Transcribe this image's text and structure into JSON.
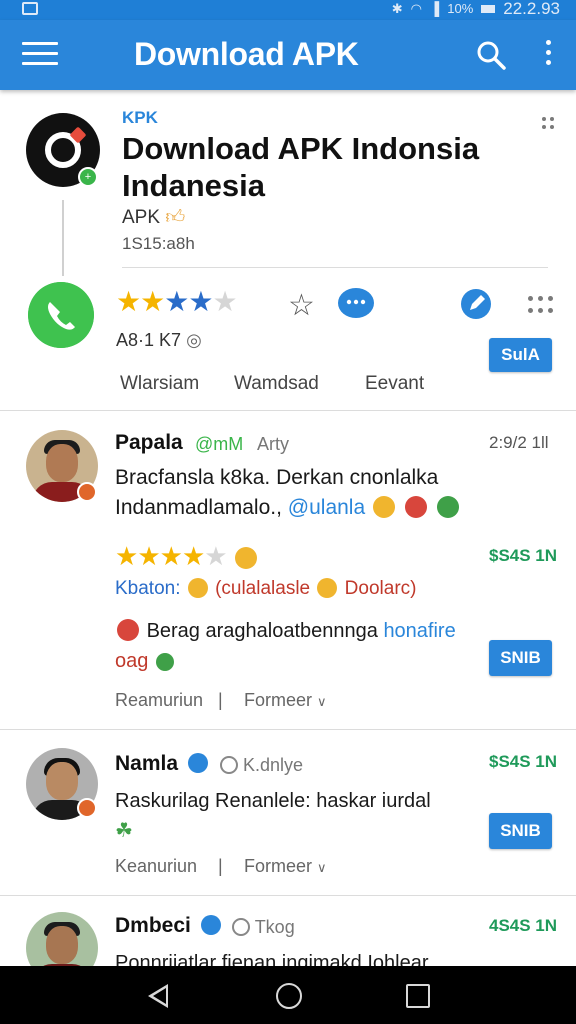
{
  "status_bar": {
    "time": "22.2.93",
    "battery_text": "10%"
  },
  "app_bar": {
    "title": "Download APK"
  },
  "header": {
    "kicker": "KPK",
    "title": "Download APK Indonsia Indanesia",
    "subtitle": "APK",
    "meta": "1S15:a8h",
    "rating_count": "A8·1 K7",
    "action_button": "SulA",
    "rating": 3.5,
    "tabs": [
      "Wlarsiam",
      "Wamdsad",
      "Eevant"
    ]
  },
  "reviews": [
    {
      "name": "Papala",
      "tag": "@mM",
      "sub": "Arty",
      "date": "2:9/2 1ll",
      "text_line1": "Bracfansla k8ka. Derkan cnonlalka",
      "text_line2": "Indanmadlamalo.,",
      "mention": "@ulanla",
      "price": "$S4S 1N",
      "line_prefix": "Kbaton:",
      "line_red": "(culalalasle",
      "line_red2": "Doolarc)",
      "line3_text": "Berag araghaloatbennnga",
      "line3_blue": "honafire",
      "line4_text": "oag",
      "button": "SNIB",
      "footer_left": "Reamuriun",
      "footer_right": "Formeer",
      "rating": 3.5
    },
    {
      "name": "Namla",
      "sub": "K.dnlye",
      "price": "$S4S 1N",
      "text_line1": "Raskurilag Renanlele: haskar iurdal",
      "button": "SNIB",
      "footer_left": "Keanuriun",
      "footer_right": "Formeer"
    },
    {
      "name": "Dmbeci",
      "sub": "Tkog",
      "price": "4S4S 1N",
      "text_line1": "Ponnrijatlar fienan inqimakd Iohlear"
    }
  ],
  "colors": {
    "primary": "#2a86da",
    "star": "#f5b400",
    "price_green": "#1f9a5a",
    "whatsapp": "#3fc24f"
  }
}
